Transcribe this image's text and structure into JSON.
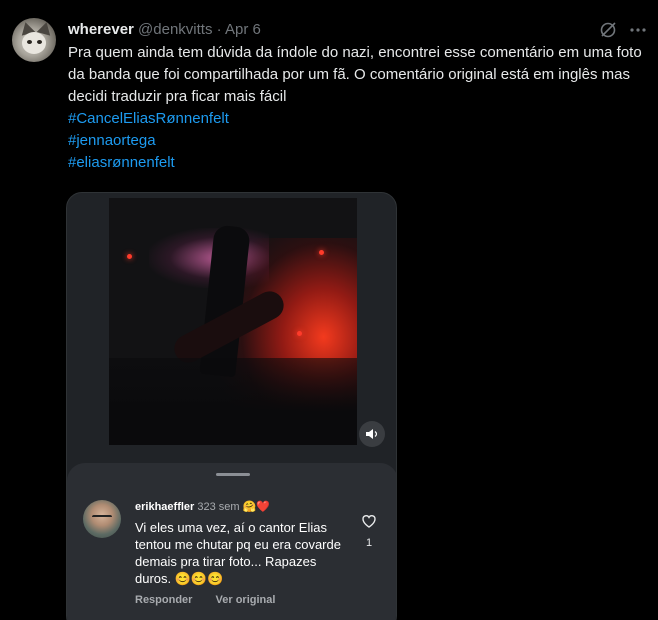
{
  "author": {
    "name": "wherever",
    "handle": "@denkvitts",
    "separator": "·",
    "date": "Apr 6"
  },
  "tweet": {
    "text": "Pra quem ainda tem dúvida da índole do nazi, encontrei esse comentário em uma foto da banda que foi compartilhada por um fã. O comentário original está em inglês mas decidi traduzir pra ficar mais fácil",
    "hashtags": [
      "#CancelEliasRønnenfelt",
      "#jennaortega",
      "#eliasrønnenfelt"
    ]
  },
  "header_icons": [
    "grok-icon",
    "more-icon"
  ],
  "media": {
    "mute_icon": "volume-icon",
    "comment": {
      "username": "erikhaeffler",
      "meta": "323 sem",
      "emoji": "🤗❤️",
      "text": "Vi eles uma vez, aí o cantor Elias tentou me chutar pq eu era covarde demais pra tirar foto... Rapazes duros. 😊😊😊",
      "like_count": "1",
      "reply_label": "Responder",
      "original_label": "Ver original"
    }
  },
  "colors": {
    "background": "#000000",
    "text": "#e7e9ea",
    "muted": "#71767b",
    "link": "#1d9bf0",
    "sheet": "#2b2e33"
  }
}
